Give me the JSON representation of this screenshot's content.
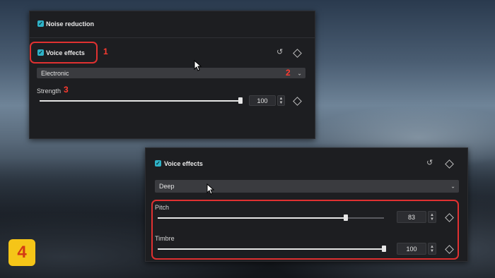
{
  "panel1": {
    "noise_reduction": {
      "label": "Noise reduction",
      "checked": true
    },
    "voice_effects": {
      "label": "Voice effects",
      "checked": true
    },
    "dropdown": {
      "value": "Electronic"
    },
    "strength": {
      "label": "Strength",
      "value": "100",
      "level": 1.0
    }
  },
  "panel2": {
    "voice_effects": {
      "label": "Voice effects",
      "checked": true
    },
    "dropdown": {
      "value": "Deep"
    },
    "pitch": {
      "label": "Pitch",
      "value": "83",
      "level": 0.83
    },
    "timbre": {
      "label": "Timbre",
      "value": "100",
      "level": 1.0
    }
  },
  "annotations": {
    "n1": "1",
    "n2": "2",
    "n3": "3"
  },
  "badge": "4",
  "icons": {
    "checkbox": "check-icon",
    "reset": "reset-icon",
    "keyframe": "keyframe-diamond-icon",
    "dropdown": "chevron-down-icon",
    "stepper": "stepper-arrows-icon",
    "cursor": "mouse-cursor-icon"
  },
  "colors": {
    "accent": "#2fb3c8",
    "highlight": "#e03131",
    "badge": "#f5c518"
  }
}
